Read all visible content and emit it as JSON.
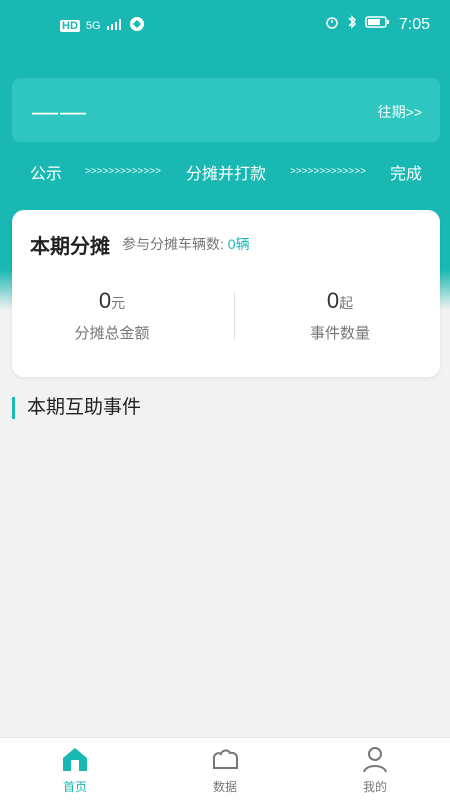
{
  "status": {
    "left_badges": [
      "HD",
      "5G"
    ],
    "time": "7:05",
    "icons": [
      "alarm-icon",
      "bluetooth-icon",
      "battery-icon"
    ]
  },
  "top": {
    "period": "——",
    "past_link": "往期>>"
  },
  "steps": {
    "s1": "公示",
    "arrows": ">>>>>>>>>>>>>",
    "s2": "分摊并打款",
    "s3": "完成"
  },
  "summary": {
    "title": "本期分摊",
    "participants_label": "参与分摊车辆数:",
    "participants_value": "0辆",
    "total": {
      "value": "0",
      "unit": "元",
      "label": "分摊总金额"
    },
    "events": {
      "value": "0",
      "unit": "起",
      "label": "事件数量"
    }
  },
  "events": {
    "title": "本期互助事件"
  },
  "tabs": [
    {
      "label": "首页",
      "icon": "home-icon",
      "active": true
    },
    {
      "label": "数据",
      "icon": "data-icon",
      "active": false
    },
    {
      "label": "我的",
      "icon": "profile-icon",
      "active": false
    }
  ],
  "colors": {
    "brand": "#19b8b2",
    "card": "#2ec6bf"
  }
}
